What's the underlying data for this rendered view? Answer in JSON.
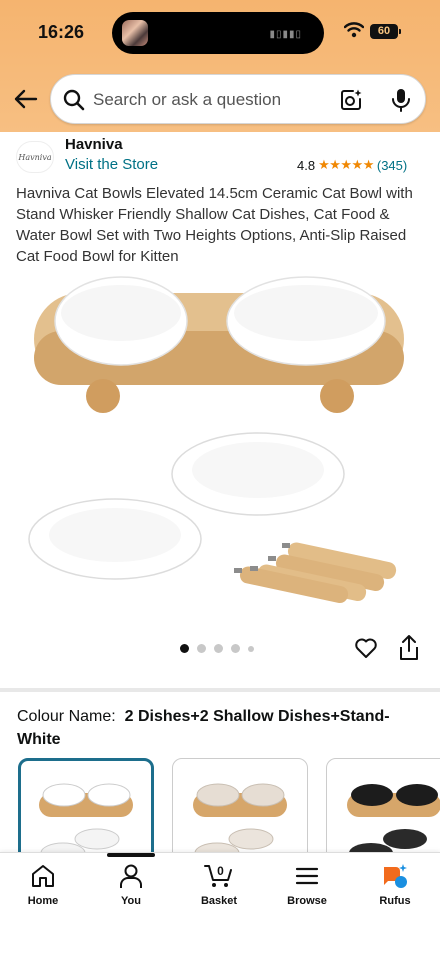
{
  "status_bar": {
    "time": "16:26",
    "battery": "60"
  },
  "search": {
    "placeholder": "Search or ask a question"
  },
  "store": {
    "logo_text": "Havniva",
    "name": "Havniva",
    "visit_link": "Visit the Store",
    "rating": "4.8",
    "stars": "★★★★★",
    "rating_count": "(345)"
  },
  "product": {
    "title": "Havniva Cat Bowls Elevated 14.5cm Ceramic Cat Bowl with Stand Whisker Friendly Shallow Cat Dishes, Cat Food & Water Bowl Set with Two Heights Options, Anti-Slip Raised Cat Food Bowl for Kitten",
    "image_count": 5,
    "current_image": 1
  },
  "variant": {
    "label": "Colour Name:",
    "value": "2 Dishes+2 Shallow Dishes+Stand- White",
    "options": [
      {
        "name": "white",
        "bowl_color": "#ffffff",
        "dish_color": "#f4f4f4",
        "selected": true
      },
      {
        "name": "beige",
        "bowl_color": "#e6ddd3",
        "dish_color": "#ebe4dc",
        "selected": false
      },
      {
        "name": "black",
        "bowl_color": "#1c1c1c",
        "dish_color": "#2a2a2a",
        "selected": false
      }
    ]
  },
  "colors": {
    "header_bg": "#f5b46f",
    "link": "#007185",
    "star": "#f08804",
    "rufus": "#f26b1d",
    "selected_border": "#1d6e8c"
  },
  "nav": {
    "items": [
      {
        "label": "Home",
        "icon": "home-icon"
      },
      {
        "label": "You",
        "icon": "user-icon"
      },
      {
        "label": "Basket",
        "icon": "basket-icon",
        "badge": "0"
      },
      {
        "label": "Browse",
        "icon": "menu-icon"
      },
      {
        "label": "Rufus",
        "icon": "rufus-icon"
      }
    ]
  }
}
